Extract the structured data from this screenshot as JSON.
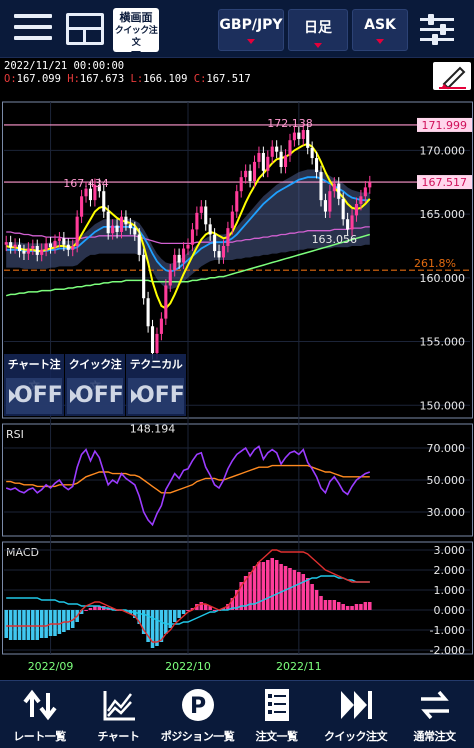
{
  "header": {
    "mode_button": {
      "line1": "横画面",
      "line2": "クイック注文"
    },
    "currency_pair": "GBP/JPY",
    "timeframe": "日足",
    "price_side": "ASK"
  },
  "chart_info": {
    "datetime": "2022/11/21 00:00:00",
    "open_key": "O:",
    "open": "167.099",
    "high_key": "H:",
    "high": "167.673",
    "low_key": "L:",
    "low": "166.109",
    "close_key": "C:",
    "close": "167.517"
  },
  "toggles": [
    {
      "label": "チャート注文",
      "state": "OFF"
    },
    {
      "label": "クイック注文",
      "state": "OFF"
    },
    {
      "label": "テクニカル",
      "state": "OFF"
    }
  ],
  "colors": {
    "up_candle": "#ff3c9a",
    "down_candle": "#ffffff",
    "ma_fast": "#ffff00",
    "ma_mid": "#1fa0ff",
    "ma_slow": "#7dff7d",
    "ma_long": "#d060d0",
    "rsi": "#9b3cff",
    "rsi_signal": "#ff8a20",
    "macd": "#e03030",
    "macd_signal": "#20c8e8",
    "hist_pos": "#ff3c9a",
    "hist_neg": "#40c8f0",
    "fib": "#e06a10"
  },
  "icons": {
    "draw": "pen-icon",
    "settings": "sliders-icon"
  },
  "chart_data": [
    {
      "type": "line",
      "panel": "price",
      "ylim": [
        149.0,
        173.8
      ],
      "ticks": [
        "170.000",
        "165.000",
        "160.000",
        "155.000",
        "150.000"
      ],
      "tick_values": [
        170,
        165,
        160,
        155,
        150
      ],
      "x_ticks": [
        "2022/09",
        "2022/10",
        "2022/11"
      ],
      "labels": {
        "high": "172.138",
        "pre_high": "167.434",
        "recent_low": "163.056",
        "low": "148.194",
        "line_upper": "171.999",
        "current": "167.517",
        "fib": "261.8%"
      },
      "label_values": {
        "high": 172.138,
        "pre_high": 167.434,
        "recent_low": 163.056,
        "low": 148.194,
        "line_upper": 171.999,
        "current": 167.517,
        "fib": 160.6
      },
      "close": [
        162.8,
        162.4,
        162.6,
        162.1,
        161.9,
        162.3,
        162.5,
        161.8,
        162.2,
        162.7,
        162.4,
        162.9,
        163.1,
        162.6,
        162.2,
        162.5,
        164.8,
        166.4,
        167.0,
        166.1,
        167.3,
        166.8,
        165.2,
        163.5,
        164.1,
        163.6,
        164.8,
        164.2,
        163.9,
        163.4,
        161.8,
        158.4,
        156.2,
        154.1,
        155.6,
        156.8,
        159.4,
        160.6,
        161.8,
        161.2,
        162.3,
        162.6,
        163.8,
        165.1,
        165.6,
        164.2,
        163.4,
        162.1,
        161.6,
        162.5,
        163.9,
        165.2,
        166.8,
        167.9,
        168.4,
        167.6,
        169.1,
        169.8,
        168.4,
        169.5,
        170.3,
        169.9,
        168.7,
        169.6,
        170.8,
        171.4,
        170.9,
        171.6,
        170.2,
        169.4,
        168.3,
        166.1,
        165.2,
        166.8,
        167.4,
        166.2,
        164.6,
        163.8,
        164.9,
        165.8,
        166.4,
        167.1,
        167.5
      ],
      "ma_fast": [
        162.5,
        162.4,
        162.4,
        162.3,
        162.2,
        162.2,
        162.2,
        162.1,
        162.1,
        162.2,
        162.3,
        162.4,
        162.5,
        162.5,
        162.4,
        162.4,
        162.8,
        163.4,
        164.0,
        164.6,
        165.2,
        165.5,
        165.6,
        165.3,
        165.0,
        164.7,
        164.5,
        164.4,
        164.3,
        164.1,
        163.6,
        162.5,
        161.2,
        159.7,
        158.6,
        157.8,
        157.6,
        158.0,
        158.7,
        159.5,
        160.3,
        161.0,
        161.7,
        162.4,
        163.0,
        163.4,
        163.6,
        163.5,
        163.3,
        163.1,
        163.2,
        163.6,
        164.3,
        165.1,
        165.9,
        166.6,
        167.2,
        167.8,
        168.2,
        168.6,
        169.0,
        169.3,
        169.4,
        169.5,
        169.7,
        170.0,
        170.2,
        170.4,
        170.5,
        170.3,
        169.8,
        169.1,
        168.3,
        167.6,
        167.1,
        166.7,
        166.3,
        165.8,
        165.5,
        165.4,
        165.5,
        165.8,
        166.2
      ],
      "ma_mid": [
        162.2,
        162.2,
        162.2,
        162.2,
        162.1,
        162.1,
        162.1,
        162.1,
        162.1,
        162.1,
        162.2,
        162.2,
        162.3,
        162.3,
        162.3,
        162.3,
        162.4,
        162.7,
        163.0,
        163.3,
        163.6,
        163.8,
        164.0,
        164.0,
        164.0,
        164.0,
        164.0,
        164.0,
        164.0,
        163.9,
        163.7,
        163.2,
        162.6,
        161.9,
        161.3,
        160.9,
        160.6,
        160.5,
        160.6,
        160.8,
        161.1,
        161.4,
        161.7,
        162.0,
        162.3,
        162.5,
        162.7,
        162.8,
        162.8,
        162.8,
        162.9,
        163.1,
        163.4,
        163.8,
        164.2,
        164.6,
        165.0,
        165.4,
        165.8,
        166.1,
        166.4,
        166.7,
        166.9,
        167.1,
        167.3,
        167.5,
        167.7,
        167.8,
        167.9,
        167.9,
        167.9,
        167.8,
        167.6,
        167.4,
        167.2,
        167.0,
        166.8,
        166.5,
        166.3,
        166.2,
        166.1,
        166.1,
        166.1
      ],
      "ma_slow": [
        158.6,
        158.7,
        158.7,
        158.8,
        158.8,
        158.9,
        158.9,
        158.9,
        159.0,
        159.0,
        159.0,
        159.1,
        159.1,
        159.1,
        159.2,
        159.2,
        159.3,
        159.3,
        159.4,
        159.4,
        159.5,
        159.5,
        159.6,
        159.6,
        159.7,
        159.7,
        159.7,
        159.8,
        159.8,
        159.8,
        159.8,
        159.8,
        159.8,
        159.7,
        159.7,
        159.7,
        159.7,
        159.7,
        159.7,
        159.7,
        159.7,
        159.7,
        159.8,
        159.8,
        159.9,
        159.9,
        160.0,
        160.0,
        160.1,
        160.1,
        160.2,
        160.3,
        160.4,
        160.5,
        160.6,
        160.7,
        160.8,
        160.9,
        161.0,
        161.1,
        161.2,
        161.3,
        161.4,
        161.5,
        161.6,
        161.7,
        161.8,
        161.9,
        162.0,
        162.1,
        162.2,
        162.3,
        162.4,
        162.5,
        162.6,
        162.7,
        162.8,
        162.9,
        163.0,
        163.1,
        163.2,
        163.3,
        163.4
      ],
      "ma_long": [
        163.6,
        163.6,
        163.5,
        163.5,
        163.4,
        163.4,
        163.3,
        163.3,
        163.3,
        163.2,
        163.2,
        163.2,
        163.2,
        163.1,
        163.1,
        163.1,
        163.1,
        163.1,
        163.2,
        163.2,
        163.2,
        163.3,
        163.3,
        163.3,
        163.3,
        163.3,
        163.3,
        163.3,
        163.3,
        163.3,
        163.2,
        163.1,
        163.0,
        162.9,
        162.8,
        162.7,
        162.7,
        162.7,
        162.7,
        162.7,
        162.7,
        162.7,
        162.7,
        162.8,
        162.8,
        162.8,
        162.8,
        162.8,
        162.8,
        162.8,
        162.8,
        162.8,
        162.9,
        162.9,
        163.0,
        163.0,
        163.1,
        163.1,
        163.2,
        163.2,
        163.3,
        163.3,
        163.4,
        163.4,
        163.5,
        163.5,
        163.6,
        163.6,
        163.7,
        163.7,
        163.7,
        163.7,
        163.7,
        163.7,
        163.8,
        163.8,
        163.8,
        163.8,
        163.9,
        163.9,
        163.9,
        164.0,
        164.0
      ]
    },
    {
      "type": "line",
      "panel": "RSI",
      "title": "RSI",
      "ylim": [
        15,
        85
      ],
      "ticks": [
        "70.000",
        "50.000",
        "30.000"
      ],
      "tick_values": [
        70,
        50,
        30
      ],
      "rsi": [
        45,
        44,
        45,
        43,
        42,
        44,
        45,
        42,
        44,
        47,
        45,
        48,
        50,
        46,
        44,
        46,
        58,
        66,
        69,
        62,
        68,
        64,
        55,
        47,
        50,
        48,
        54,
        51,
        49,
        47,
        40,
        30,
        25,
        22,
        29,
        34,
        44,
        49,
        54,
        51,
        56,
        57,
        62,
        66,
        67,
        58,
        53,
        47,
        45,
        50,
        57,
        62,
        66,
        68,
        70,
        65,
        69,
        71,
        63,
        67,
        69,
        67,
        60,
        64,
        67,
        68,
        66,
        69,
        61,
        57,
        52,
        45,
        42,
        49,
        52,
        48,
        43,
        41,
        46,
        50,
        52,
        54,
        55
      ],
      "signal": [
        49,
        49,
        48,
        48,
        47,
        47,
        47,
        46,
        46,
        46,
        46,
        46,
        47,
        47,
        47,
        47,
        48,
        50,
        52,
        53,
        54,
        55,
        55,
        55,
        54,
        54,
        54,
        54,
        53,
        53,
        52,
        50,
        48,
        46,
        44,
        42,
        42,
        42,
        43,
        44,
        45,
        46,
        47,
        49,
        50,
        51,
        51,
        51,
        50,
        50,
        51,
        52,
        53,
        54,
        55,
        56,
        57,
        58,
        58,
        58,
        59,
        59,
        59,
        59,
        59,
        59,
        59,
        59,
        59,
        58,
        57,
        56,
        55,
        55,
        54,
        53,
        52,
        52,
        52,
        52,
        52,
        52,
        52
      ]
    },
    {
      "type": "bar",
      "panel": "MACD",
      "title": "MACD",
      "ylim": [
        -2.2,
        3.4
      ],
      "ticks": [
        "3.000",
        "2.000",
        "1.000",
        "0.000",
        "-1.000",
        "-2.000"
      ],
      "tick_values": [
        3,
        2,
        1,
        0,
        -1,
        -2
      ],
      "histogram": [
        -1.4,
        -1.5,
        -1.5,
        -1.5,
        -1.5,
        -1.5,
        -1.5,
        -1.5,
        -1.4,
        -1.4,
        -1.3,
        -1.3,
        -1.2,
        -1.1,
        -1.0,
        -0.9,
        -0.6,
        -0.2,
        0.0,
        0.1,
        0.2,
        0.2,
        0.2,
        0.1,
        0.1,
        0.0,
        0.0,
        -0.1,
        -0.2,
        -0.4,
        -0.7,
        -1.2,
        -1.6,
        -1.9,
        -1.8,
        -1.6,
        -1.2,
        -0.9,
        -0.6,
        -0.4,
        -0.2,
        0.0,
        0.1,
        0.3,
        0.4,
        0.3,
        0.2,
        0.0,
        0.0,
        0.1,
        0.3,
        0.6,
        1.0,
        1.4,
        1.7,
        1.9,
        2.2,
        2.4,
        2.4,
        2.5,
        2.6,
        2.5,
        2.3,
        2.2,
        2.1,
        2.0,
        1.9,
        1.8,
        1.6,
        1.3,
        1.0,
        0.7,
        0.5,
        0.5,
        0.5,
        0.4,
        0.3,
        0.2,
        0.2,
        0.3,
        0.3,
        0.4,
        0.4
      ],
      "macd": [
        -0.8,
        -0.8,
        -0.8,
        -0.8,
        -0.8,
        -0.8,
        -0.8,
        -0.8,
        -0.8,
        -0.8,
        -0.7,
        -0.7,
        -0.7,
        -0.6,
        -0.6,
        -0.5,
        -0.3,
        0.0,
        0.2,
        0.3,
        0.4,
        0.4,
        0.3,
        0.2,
        0.1,
        0.0,
        0.0,
        -0.1,
        -0.2,
        -0.3,
        -0.6,
        -1.0,
        -1.3,
        -1.6,
        -1.6,
        -1.5,
        -1.2,
        -1.0,
        -0.7,
        -0.5,
        -0.3,
        -0.1,
        0.0,
        0.2,
        0.3,
        0.3,
        0.2,
        0.1,
        0.0,
        0.1,
        0.2,
        0.5,
        0.8,
        1.2,
        1.5,
        1.8,
        2.1,
        2.4,
        2.6,
        2.8,
        3.0,
        3.0,
        2.9,
        2.9,
        2.9,
        2.9,
        2.9,
        2.9,
        2.8,
        2.6,
        2.4,
        2.2,
        2.0,
        1.9,
        1.8,
        1.7,
        1.6,
        1.5,
        1.4,
        1.4,
        1.4,
        1.4,
        1.4
      ],
      "signal": [
        0.6,
        0.6,
        0.6,
        0.6,
        0.6,
        0.6,
        0.6,
        0.6,
        0.5,
        0.5,
        0.5,
        0.5,
        0.4,
        0.4,
        0.3,
        0.3,
        0.3,
        0.2,
        0.2,
        0.2,
        0.2,
        0.2,
        0.1,
        0.1,
        0.0,
        0.0,
        0.0,
        0.0,
        -0.1,
        -0.1,
        -0.2,
        -0.2,
        -0.3,
        -0.4,
        -0.5,
        -0.6,
        -0.7,
        -0.7,
        -0.7,
        -0.7,
        -0.6,
        -0.6,
        -0.5,
        -0.4,
        -0.3,
        -0.2,
        -0.1,
        -0.1,
        0.0,
        0.0,
        0.0,
        0.1,
        0.1,
        0.2,
        0.2,
        0.3,
        0.3,
        0.4,
        0.5,
        0.6,
        0.7,
        0.8,
        0.9,
        1.0,
        1.1,
        1.2,
        1.3,
        1.4,
        1.5,
        1.6,
        1.6,
        1.7,
        1.7,
        1.7,
        1.7,
        1.6,
        1.6,
        1.5,
        1.5,
        1.4,
        1.4,
        1.4,
        1.4
      ]
    }
  ],
  "nav": [
    {
      "label": "レート一覧",
      "icon": "rate-list-icon"
    },
    {
      "label": "チャート",
      "icon": "chart-icon"
    },
    {
      "label": "ポジション一覧",
      "icon": "position-icon"
    },
    {
      "label": "注文一覧",
      "icon": "order-list-icon"
    },
    {
      "label": "クイック注文",
      "icon": "quick-order-icon"
    },
    {
      "label": "通常注文",
      "icon": "normal-order-icon"
    }
  ]
}
